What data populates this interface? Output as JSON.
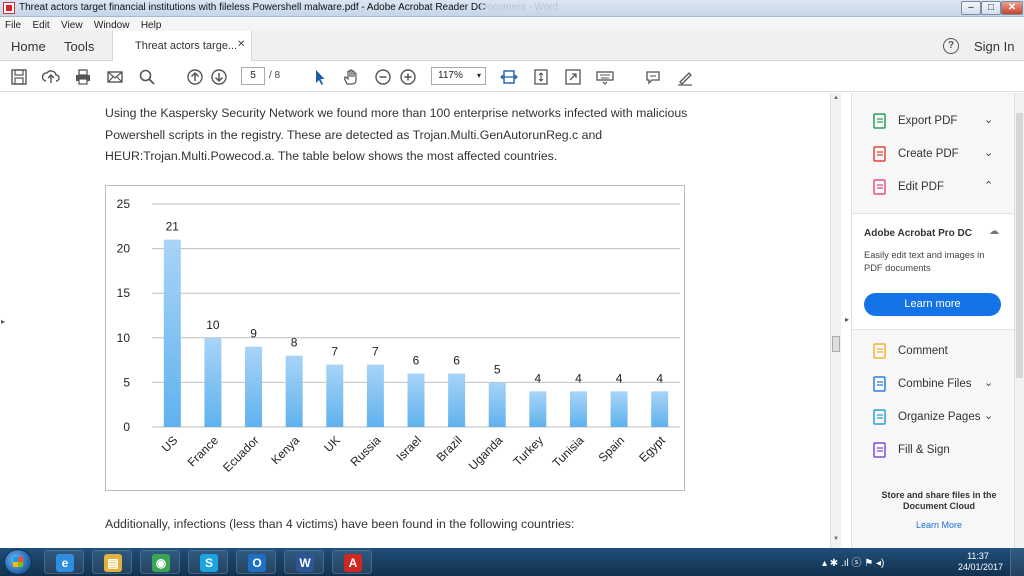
{
  "window": {
    "title": "Threat actors target financial institutions with fileless Powershell malware.pdf - Adobe Acrobat Reader DC",
    "ghost_text": "Document - Word",
    "min_symbol": "–",
    "max_symbol": "□",
    "close_symbol": "✕"
  },
  "menu": [
    "File",
    "Edit",
    "View",
    "Window",
    "Help"
  ],
  "tabs": {
    "home": "Home",
    "tools": "Tools",
    "document": "Threat actors targe...",
    "close_symbol": "✕",
    "help_symbol": "?",
    "sign_in": "Sign In"
  },
  "toolbar": {
    "page_current": "5",
    "page_total": "/ 8",
    "zoom": "117%",
    "zoom_arrow": "▾",
    "icons": [
      "save-icon",
      "upload-icon",
      "print-icon",
      "email-icon",
      "search-icon",
      "page-up-icon",
      "page-down-icon",
      "select-pointer-icon",
      "hand-tool-icon",
      "zoom-out-icon",
      "zoom-in-icon",
      "fit-width-icon",
      "fit-page-icon",
      "full-screen-icon",
      "keyboard-icon",
      "comment-icon",
      "highlight-icon"
    ]
  },
  "document": {
    "paragraph1": "Using the Kaspersky Security Network we found more than 100 enterprise networks infected with malicious Powershell scripts in the registry. These are detected as Trojan.Multi.GenAutorunReg.c and HEUR:Trojan.Multi.Powecod.a. The table below shows the most affected countries.",
    "paragraph2": "Additionally, infections (less than 4 victims) have been found in the following countries:"
  },
  "chart_data": {
    "type": "bar",
    "categories": [
      "US",
      "France",
      "Ecuador",
      "Kenya",
      "UK",
      "Russia",
      "Israel",
      "Brazil",
      "Uganda",
      "Turkey",
      "Tunisia",
      "Spain",
      "Egypt"
    ],
    "values": [
      21,
      10,
      9,
      8,
      7,
      7,
      6,
      6,
      5,
      4,
      4,
      4,
      4
    ],
    "data_labels": [
      "21",
      "10",
      "9",
      "8",
      "7",
      "7",
      "6",
      "6",
      "5",
      "4",
      "4",
      "4",
      "4"
    ],
    "yticks": [
      0,
      5,
      10,
      15,
      20,
      25
    ],
    "ylim": [
      0,
      25
    ],
    "grid": true,
    "colors": {
      "bar_top": "#a9d4f7",
      "bar_bottom": "#5fb2ee",
      "grid": "#bfbfbf"
    }
  },
  "rightpane": {
    "tools": [
      {
        "label": "Export PDF",
        "chevron": "⌄",
        "icon": "export-pdf-icon",
        "color": "#2e9e5b"
      },
      {
        "label": "Create PDF",
        "chevron": "⌄",
        "icon": "create-pdf-icon",
        "color": "#e0463b"
      },
      {
        "label": "Edit PDF",
        "chevron": "⌃",
        "icon": "edit-pdf-icon",
        "color": "#e3508f"
      }
    ],
    "promo": {
      "heading": "Adobe Acrobat Pro DC",
      "description": "Easily edit text and images in PDF documents",
      "button": "Learn more",
      "cloud_symbol": "☁"
    },
    "tools2": [
      {
        "label": "Comment",
        "chevron": "",
        "icon": "comment-icon",
        "color": "#f2b431"
      },
      {
        "label": "Combine Files",
        "chevron": "⌄",
        "icon": "combine-files-icon",
        "color": "#2f7fd8"
      },
      {
        "label": "Organize Pages",
        "chevron": "⌄",
        "icon": "organize-pages-icon",
        "color": "#2a9fd6"
      },
      {
        "label": "Fill & Sign",
        "chevron": "",
        "icon": "fill-sign-icon",
        "color": "#7b4fd1"
      }
    ],
    "store": "Store and share files in the Document Cloud",
    "learn_more": "Learn More"
  },
  "taskbar": {
    "apps": [
      {
        "name": "internet-explorer-icon",
        "glyph": "e",
        "color": "#2f8ee0"
      },
      {
        "name": "file-explorer-icon",
        "glyph": "▤",
        "color": "#e4b23c"
      },
      {
        "name": "chrome-icon",
        "glyph": "◉",
        "color": "#3aa655"
      },
      {
        "name": "skype-icon",
        "glyph": "S",
        "color": "#1aa4e0"
      },
      {
        "name": "outlook-icon",
        "glyph": "O",
        "color": "#1f6fc5"
      },
      {
        "name": "word-icon",
        "glyph": "W",
        "color": "#2b5797"
      },
      {
        "name": "acrobat-icon",
        "glyph": "A",
        "color": "#d3261e"
      }
    ],
    "tray": "▴  ✱  .ıl  ⓢ  ⚑  ◂)",
    "time": "11:37",
    "date": "24/01/2017"
  }
}
